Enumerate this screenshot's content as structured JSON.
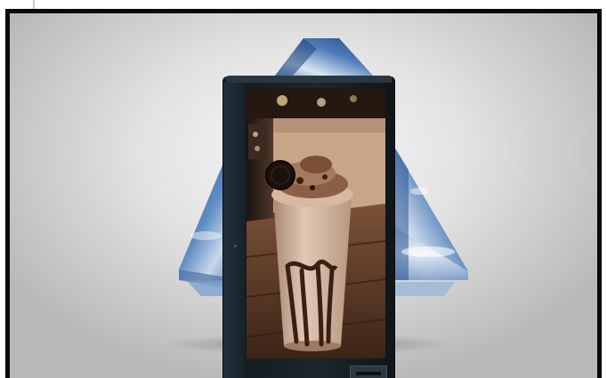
{
  "scene": {
    "subject": "digital-signage-kiosk-mockup",
    "screen_content": "chocolate-cookie-milkshake",
    "colors": {
      "frame_border": "#0a0a0a",
      "background_center": "#f7f7f7",
      "background_edge": "#b8b8b8",
      "kiosk_body": "#1c262c",
      "sky_blue": "#3d6aa8",
      "table_wood": "#5a3724",
      "milkshake": "#c6a58c",
      "chocolate": "#3b1f12"
    }
  }
}
